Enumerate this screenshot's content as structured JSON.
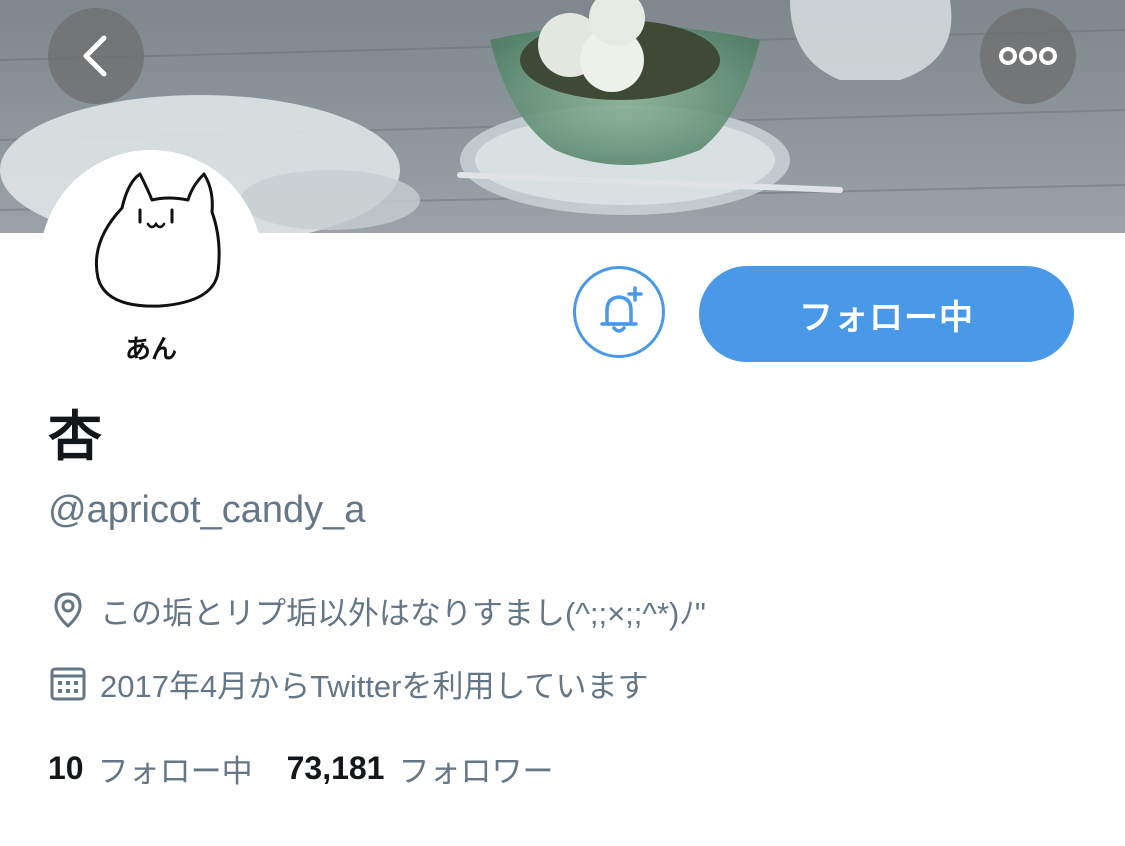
{
  "header": {
    "back_icon": "chevron-left-icon",
    "more_icon": "more-horizontal-icon"
  },
  "avatar": {
    "caption": "あん",
    "icon": "cat-drawing-avatar"
  },
  "actions": {
    "notify_icon": "bell-plus-icon",
    "follow_label": "フォロー中",
    "accent_color": "#4a99e9"
  },
  "profile": {
    "display_name": "杏",
    "handle": "@apricot_candy_a",
    "location": "この垢とリプ垢以外はなりすまし(^;;×;;^*)ﾉ\"",
    "location_icon": "location-pin-icon",
    "joined": "2017年4月からTwitterを利用しています",
    "joined_icon": "calendar-icon"
  },
  "stats": {
    "following_count": "10",
    "following_label": "フォロー中",
    "followers_count": "73,181",
    "followers_label": "フォロワー"
  }
}
